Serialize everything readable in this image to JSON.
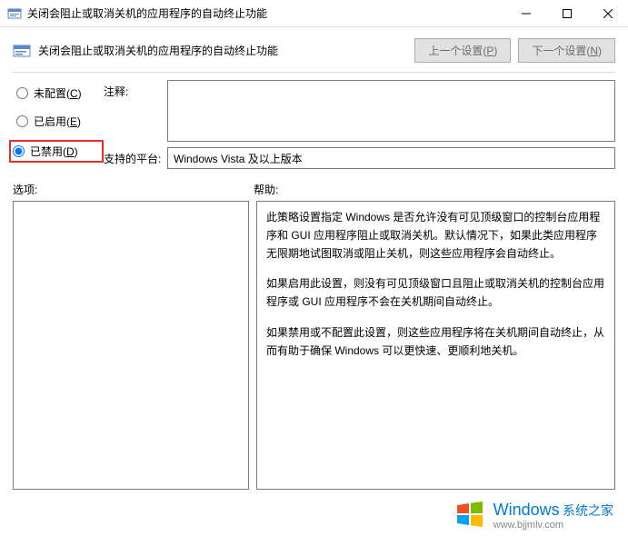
{
  "window": {
    "title": "关闭会阻止或取消关机的应用程序的自动终止功能"
  },
  "header": {
    "title": "关闭会阻止或取消关机的应用程序的自动终止功能",
    "prev_setting": "上一个设置(",
    "prev_key": "P",
    "prev_close": ")",
    "next_setting": "下一个设置(",
    "next_key": "N",
    "next_close": ")"
  },
  "radios": {
    "not_configured": "未配置(",
    "not_configured_key": "C",
    "not_configured_close": ")",
    "enabled": "已启用(",
    "enabled_key": "E",
    "enabled_close": ")",
    "disabled": "已禁用(",
    "disabled_key": "D",
    "disabled_close": ")"
  },
  "fields": {
    "comment_label": "注释:",
    "comment_value": "",
    "platform_label": "支持的平台:",
    "platform_value": "Windows Vista 及以上版本"
  },
  "lower": {
    "options_label": "选项:",
    "help_label": "帮助:"
  },
  "help": {
    "p1": "此策略设置指定 Windows 是否允许没有可见顶级窗口的控制台应用程序和 GUI 应用程序阻止或取消关机。默认情况下，如果此类应用程序无限期地试图取消或阻止关机，则这些应用程序会自动终止。",
    "p2": "如果启用此设置，则没有可见顶级窗口且阻止或取消关机的控制台应用程序或 GUI 应用程序不会在关机期间自动终止。",
    "p3": "如果禁用或不配置此设置，则这些应用程序将在关机期间自动终止，从而有助于确保 Windows 可以更快速、更顺利地关机。"
  },
  "watermark": {
    "title": "Windows",
    "subtitle": "系统之家",
    "url": "www.bjjmlv.com"
  }
}
